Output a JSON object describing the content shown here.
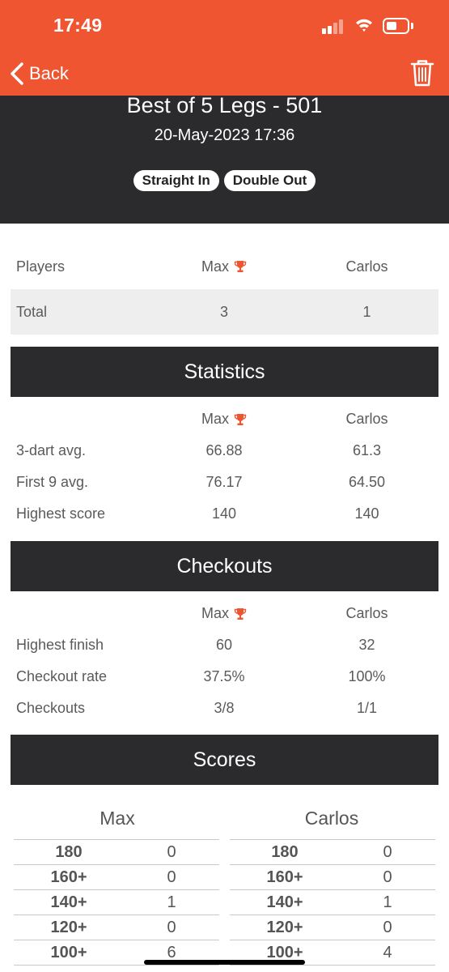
{
  "status_bar": {
    "time": "17:49"
  },
  "nav": {
    "back_label": "Back",
    "back_icon": "chevron-left-icon",
    "delete_icon": "trash-icon"
  },
  "match": {
    "title": "Best of 5 Legs - 501",
    "date": "20-May-2023 17:36",
    "tags": [
      "Straight In",
      "Double Out"
    ]
  },
  "colors": {
    "accent": "#ee5530",
    "dark": "#2b2b2d",
    "row_shade": "#eeeeee"
  },
  "legs": {
    "header": {
      "label": "Players",
      "p1": "Max",
      "p2": "Carlos",
      "winner_icon": "trophy-icon"
    },
    "total": {
      "label": "Total",
      "p1": "3",
      "p2": "1"
    }
  },
  "statistics": {
    "title": "Statistics",
    "p1": "Max",
    "p2": "Carlos",
    "rows": [
      {
        "label": "3-dart avg.",
        "p1": "66.88",
        "p2": "61.3"
      },
      {
        "label": "First 9 avg.",
        "p1": "76.17",
        "p2": "64.50"
      },
      {
        "label": "Highest score",
        "p1": "140",
        "p2": "140"
      }
    ]
  },
  "checkouts": {
    "title": "Checkouts",
    "p1": "Max",
    "p2": "Carlos",
    "rows": [
      {
        "label": "Highest finish",
        "p1": "60",
        "p2": "32"
      },
      {
        "label": "Checkout rate",
        "p1": "37.5%",
        "p2": "100%"
      },
      {
        "label": "Checkouts",
        "p1": "3/8",
        "p2": "1/1"
      }
    ]
  },
  "scores": {
    "title": "Scores",
    "players": [
      {
        "name": "Max",
        "rows": [
          {
            "label": "180",
            "value": "0"
          },
          {
            "label": "160+",
            "value": "0"
          },
          {
            "label": "140+",
            "value": "1"
          },
          {
            "label": "120+",
            "value": "0"
          },
          {
            "label": "100+",
            "value": "6"
          }
        ]
      },
      {
        "name": "Carlos",
        "rows": [
          {
            "label": "180",
            "value": "0"
          },
          {
            "label": "160+",
            "value": "0"
          },
          {
            "label": "140+",
            "value": "1"
          },
          {
            "label": "120+",
            "value": "0"
          },
          {
            "label": "100+",
            "value": "4"
          }
        ]
      }
    ]
  }
}
